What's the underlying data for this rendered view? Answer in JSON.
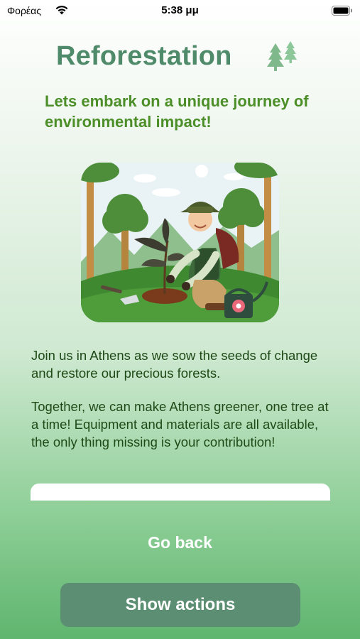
{
  "status_bar": {
    "carrier": "Φορέας",
    "time": "5:38 μμ"
  },
  "header": {
    "title": "Reforestation",
    "icon": "trees-icon"
  },
  "subtitle": "Lets embark on a unique journey of environmental impact!",
  "hero_image": {
    "icon": "gardener-planting-illustration"
  },
  "body": {
    "paragraph_1": "Join us in Athens as we sow the seeds of change and restore our precious forests.",
    "paragraph_2": "Together, we can make Athens greener, one tree at a time! Equipment and materials are all available, the only thing missing is your contribution!"
  },
  "actions": {
    "back_label": "Go back",
    "show_actions_label": "Show actions"
  },
  "colors": {
    "title": "#4f8a6a",
    "subtitle": "#4c8f28",
    "body_text": "#1f4a17",
    "button_bg": "#5b8e72"
  }
}
